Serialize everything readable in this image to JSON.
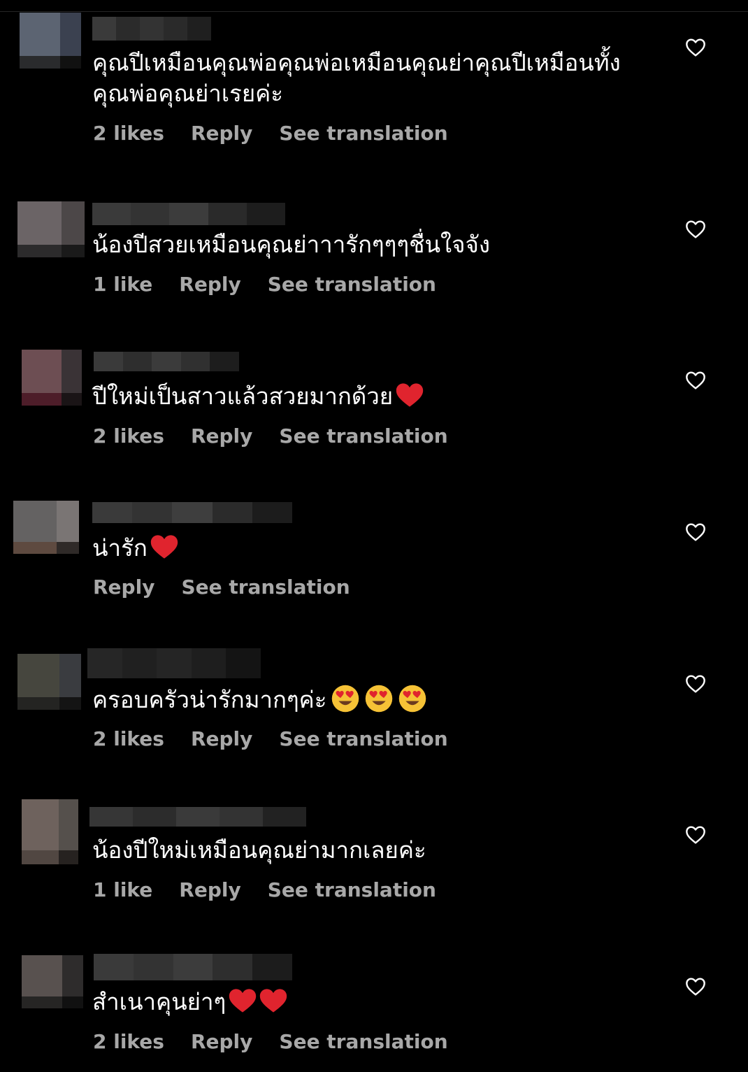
{
  "comments": [
    {
      "text": "คุณปีเหมือนคุณพ่อคุณพ่อเหมือนคุณย่าคุณปีเหมือนทั้งคุณพ่อคุณย่าเรยค่ะ",
      "likes": "2 likes",
      "reply": "Reply",
      "translate": "See translation"
    },
    {
      "text": "น้องปีสวยเหมือนคุณย่าาารักๆๆๆชื่นใจจัง",
      "likes": "1 like",
      "reply": "Reply",
      "translate": "See translation"
    },
    {
      "text": "ปีใหม่เป็นสาวแล้วสวยมากด้วย",
      "emoji": [
        "red-heart"
      ],
      "likes": "2 likes",
      "reply": "Reply",
      "translate": "See translation"
    },
    {
      "text": "น่ารัก",
      "emoji": [
        "red-heart"
      ],
      "likes": "",
      "reply": "Reply",
      "translate": "See translation"
    },
    {
      "text": "ครอบครัวน่ารักมากๆค่ะ",
      "emoji": [
        "heart-eyes-face",
        "heart-eyes-face",
        "heart-eyes-face"
      ],
      "likes": "2 likes",
      "reply": "Reply",
      "translate": "See translation"
    },
    {
      "text": "น้องปีใหม่เหมือนคุณย่ามากเลยค่ะ",
      "likes": "1 like",
      "reply": "Reply",
      "translate": "See translation"
    },
    {
      "text": "สำเนาคุนย่าๆ",
      "emoji": [
        "red-heart",
        "red-heart"
      ],
      "likes": "2 likes",
      "reply": "Reply",
      "translate": "See translation"
    }
  ],
  "icons": {
    "like": "heart-outline-icon"
  },
  "colors": {
    "background": "#000000",
    "text": "#ffffff",
    "meta": "#a8a8a8",
    "emoji_heart": "#e0242e"
  }
}
